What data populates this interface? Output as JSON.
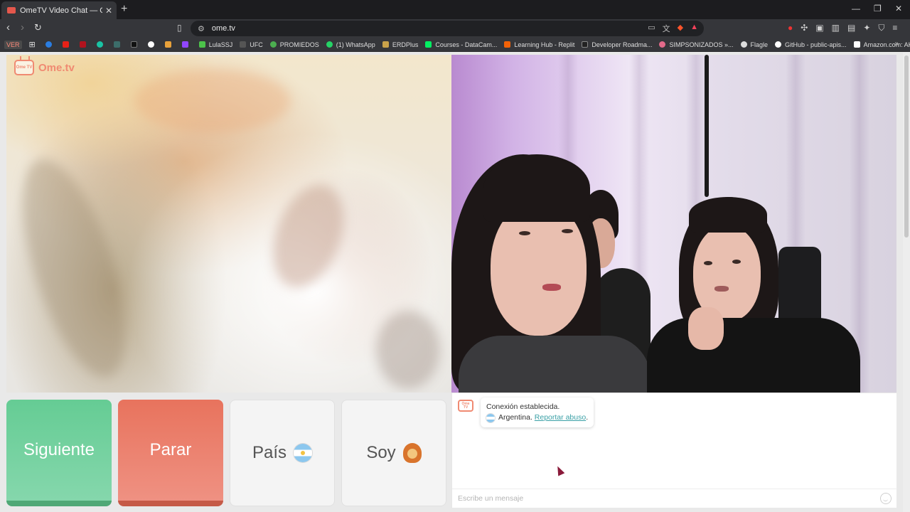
{
  "browser": {
    "tab_title": "OmeTV Video Chat — Omeg",
    "tab_close": "✕",
    "new_tab": "+",
    "url": "ome.tv",
    "bookmarks": [
      {
        "label": "LulaSSJ",
        "color": "#4cc24a"
      },
      {
        "label": "UFC",
        "color": "#777777"
      },
      {
        "label": "PROMIEDOS",
        "color": "#4caf50"
      },
      {
        "label": "(1) WhatsApp",
        "color": "#25d366"
      },
      {
        "label": "ERDPlus",
        "color": "#c9a24a"
      },
      {
        "label": "Courses - DataCam...",
        "color": "#03ef62"
      },
      {
        "label": "Learning Hub - Replit",
        "color": "#f26207"
      },
      {
        "label": "Developer Roadma...",
        "color": "#222222"
      },
      {
        "label": "SIMPSONIZADOS »...",
        "color": "#e36a8a"
      },
      {
        "label": "Flagle",
        "color": "#dddddd"
      },
      {
        "label": "GitHub - public-apis...",
        "color": "#ffffff"
      },
      {
        "label": "Amazon.com: AKRa...",
        "color": "#ffffff"
      }
    ],
    "ver_badge": "VER",
    "bookmarks_more": "»"
  },
  "site": {
    "logo_text": "Ome.tv",
    "logo_tv_text": "Ome TV"
  },
  "controls": {
    "next_label": "Siguiente",
    "stop_label": "Parar",
    "country_label": "País",
    "gender_label": "Soy"
  },
  "chat": {
    "status_message": "Conexión establecida.",
    "country": "Argentina.",
    "report_link": "Reportar abuso",
    "report_suffix": ".",
    "input_placeholder": "Escribe un mensaje"
  },
  "colors": {
    "next_button": "#65cc94",
    "stop_button": "#e8735d",
    "brand": "#f08a72",
    "link": "#3aa0a6"
  }
}
